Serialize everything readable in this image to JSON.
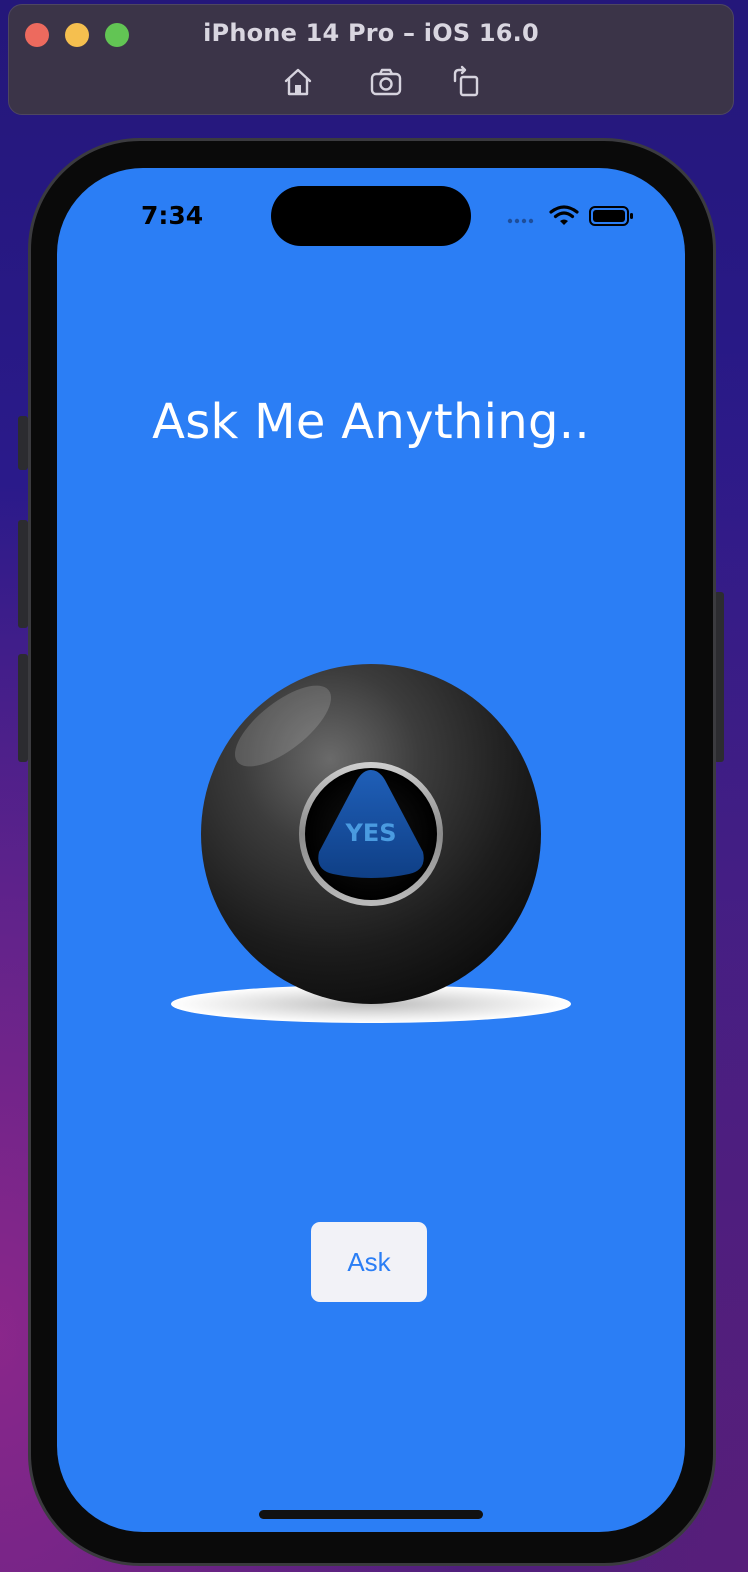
{
  "simulator": {
    "title": "iPhone 14 Pro – iOS 16.0",
    "toolbar": {
      "icons": [
        "home-icon",
        "screenshot-icon",
        "rotate-icon"
      ]
    }
  },
  "status_bar": {
    "time": "7:34",
    "icons": [
      "cellular-signal-icon",
      "wifi-icon",
      "battery-icon"
    ]
  },
  "app": {
    "headline": "Ask Me Anything..",
    "ball_answer": "YES",
    "ask_button_label": "Ask"
  },
  "colors": {
    "screen_background": "#2b7ef5",
    "button_background": "#f2f2f7",
    "button_text": "#2b7ef5",
    "answer_text": "#4a9be0"
  }
}
